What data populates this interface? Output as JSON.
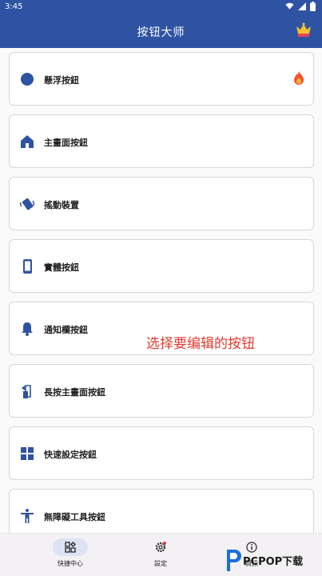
{
  "status_bar": {
    "time": "3:45"
  },
  "app_bar": {
    "title": "按钮大师"
  },
  "items": [
    {
      "label": "懸浮按鈕",
      "icon": "circle-icon"
    },
    {
      "label": "主畫面按鈕",
      "icon": "home-icon"
    },
    {
      "label": "搖動裝置",
      "icon": "shake-phone-icon"
    },
    {
      "label": "實體按鈕",
      "icon": "smartphone-icon"
    },
    {
      "label": "通知欄按鈕",
      "icon": "bell-icon"
    },
    {
      "label": "長按主畫面按鈕",
      "icon": "long-press-home-icon"
    },
    {
      "label": "快速設定按鈕",
      "icon": "grid-icon"
    },
    {
      "label": "無障礙工具按鈕",
      "icon": "accessibility-icon"
    }
  ],
  "annotation": "选择要编辑的按钮",
  "bottom_nav": [
    {
      "label": "快捷中心",
      "icon": "dashboard-icon",
      "active": true
    },
    {
      "label": "設定",
      "icon": "settings-icon",
      "active": false
    },
    {
      "label": "資訊",
      "icon": "info-icon",
      "active": false
    }
  ],
  "watermark": {
    "text": "PCPOP下载"
  },
  "colors": {
    "primary": "#2f53a3",
    "accent_red": "#e33b2f",
    "icon_blue": "#2f53a3"
  }
}
